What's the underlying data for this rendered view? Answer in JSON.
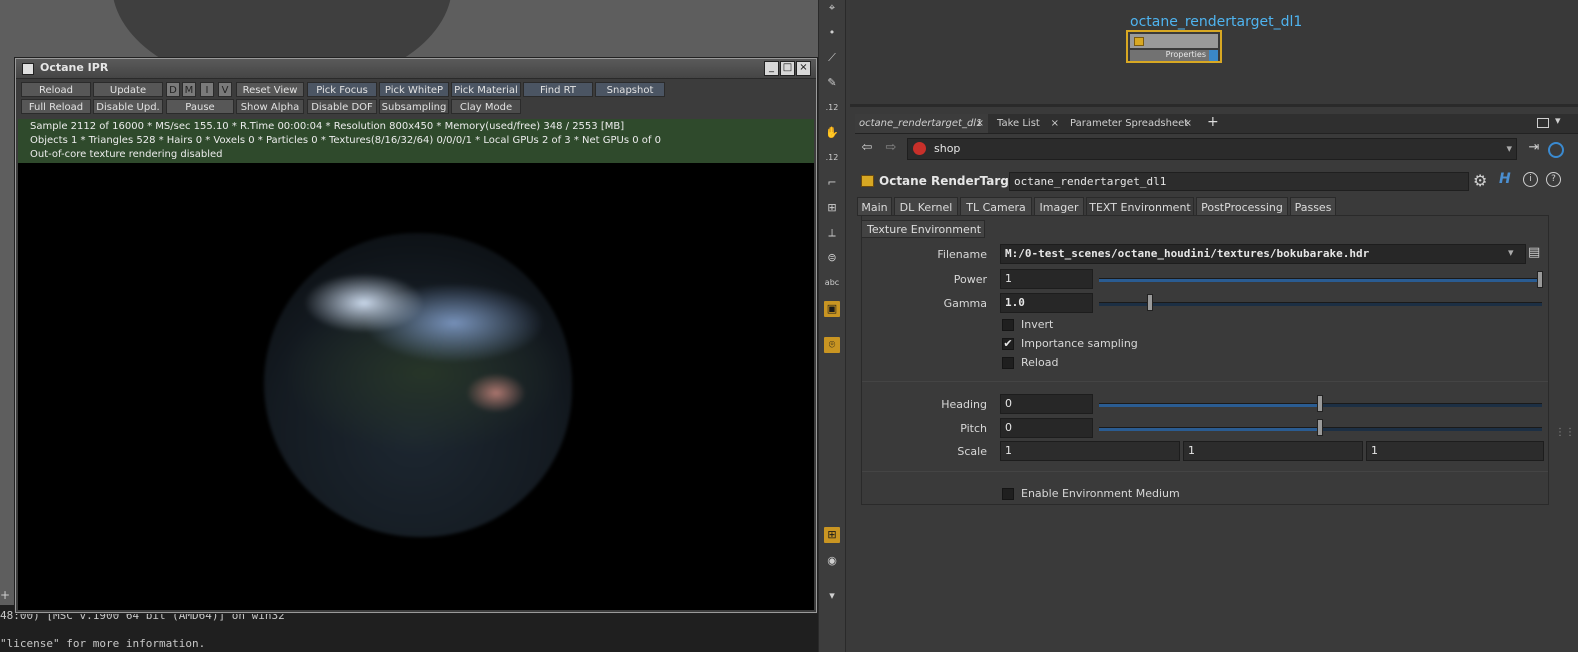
{
  "console": {
    "line1": "48:00) [MSC v.1900 64 bit (AMD64)] on win32",
    "line2": "\"license\" for more information."
  },
  "ipr": {
    "title": "Octane IPR",
    "toolbar_row1": [
      "Reload",
      "Update",
      "D",
      "M",
      "I",
      "V",
      "Reset View",
      "Pick Focus",
      "Pick WhiteP",
      "Pick Material",
      "Find RT",
      "Snapshot"
    ],
    "toolbar_row2": [
      "Full Reload",
      "Disable Upd.",
      "Pause",
      "Show Alpha",
      "Disable DOF",
      "Subsampling",
      "Clay Mode"
    ],
    "status_line1": "Sample 2112 of 16000 * MS/sec 155.10 * R.Time 00:00:04 * Resolution 800x450 * Memory(used/free) 348 / 2553 [MB]",
    "status_line2": "Objects 1 * Triangles 528 * Hairs 0 * Voxels 0 * Particles 0 * Textures(8/16/32/64) 0/0/0/1 * Local GPUs 2 of 3 * Net GPUs 0 of 0",
    "status_line3": "Out-of-core texture rendering disabled",
    "window_buttons": [
      "_",
      "□",
      "×"
    ]
  },
  "shelf": {
    "labels": [
      ".12",
      ".12",
      "abc"
    ]
  },
  "network": {
    "node_name": "octane_rendertarget_dl1",
    "node_properties": "Properties"
  },
  "pane_tabs": [
    {
      "label": "octane_rendertarget_dl1",
      "close": "×"
    },
    {
      "label": "Take List",
      "close": "×"
    },
    {
      "label": "Parameter Spreadsheet",
      "close": "×"
    }
  ],
  "pane_add": "+",
  "path": {
    "context": "shop"
  },
  "params": {
    "node_type": "Octane RenderTarget",
    "node_name": "octane_rendertarget_dl1",
    "tabs": [
      "Main",
      "DL Kernel",
      "TL Camera",
      "Imager",
      "TEXT Environment",
      "PostProcessing",
      "Passes"
    ],
    "active_tab": "TEXT Environment",
    "subtab": "Texture Environment",
    "filename_label": "Filename",
    "filename_value": "M:/0-test_scenes/octane_houdini/textures/bokubarake.hdr",
    "power_label": "Power",
    "power_value": "1",
    "power_fraction": 1.0,
    "gamma_label": "Gamma",
    "gamma_value": "1.0",
    "invert_label": "Invert",
    "invert_checked": false,
    "importance_label": "Importance sampling",
    "importance_checked": true,
    "reload_label": "Reload",
    "reload_checked": false,
    "heading_label": "Heading",
    "heading_value": "0",
    "pitch_label": "Pitch",
    "pitch_value": "0",
    "scale_label": "Scale",
    "scale_values": [
      "1",
      "1",
      "1"
    ],
    "env_medium_label": "Enable Environment Medium",
    "env_medium_checked": false,
    "check_glyph": "✔"
  },
  "colors": {
    "status_bg": "#2f4a2c",
    "node_label": "#4fb4f0",
    "node_border": "#d8a823",
    "slider": "#2a5c92"
  }
}
